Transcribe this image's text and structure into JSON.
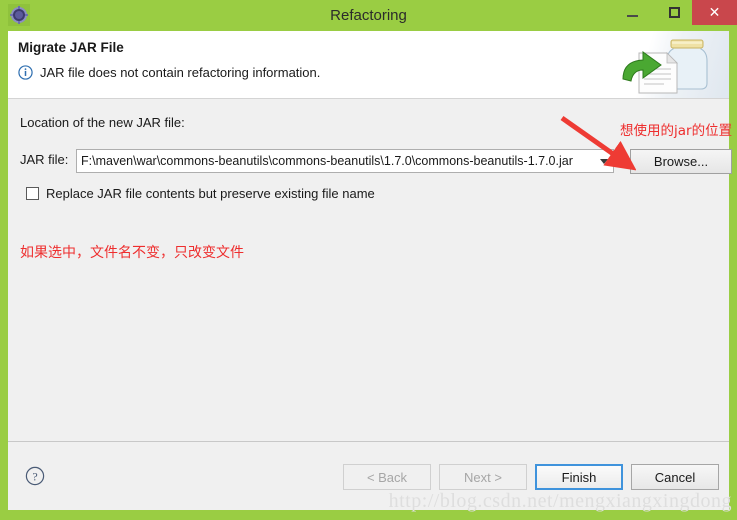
{
  "window": {
    "title": "Refactoring",
    "icon": "eclipse-gear-icon",
    "minimize_label": "–",
    "maximize_label": "□",
    "close_label": "✕",
    "chrome_color": "#9acd43",
    "close_color": "#c9474c"
  },
  "banner": {
    "title": "Migrate JAR File",
    "message": "JAR file does not contain refactoring information.",
    "info_icon": "info-circle-icon",
    "art_icon": "jar-migrate-icon"
  },
  "form": {
    "section_label": "Location of the new JAR file:",
    "jar_file_label": "JAR file:",
    "jar_file_value": "F:\\maven\\war\\commons-beanutils\\commons-beanutils\\1.7.0\\commons-beanutils-1.7.0.jar",
    "browse_label": "Browse...",
    "checkbox_label": "Replace JAR file contents but preserve existing file name",
    "checkbox_checked": false
  },
  "annotations": {
    "jar_location_note": "想使用的jar的位置",
    "checkbox_note": "如果选中，文件名不变，只改变文件",
    "color": "#ee2e2e",
    "arrow_icon": "red-arrow-icon"
  },
  "footer": {
    "help_icon": "help-circle-icon",
    "buttons": [
      {
        "label": "< Back",
        "state": "disabled"
      },
      {
        "label": "Next >",
        "state": "disabled"
      },
      {
        "label": "Finish",
        "state": "default"
      },
      {
        "label": "Cancel",
        "state": "normal"
      }
    ]
  },
  "watermark": {
    "text": "http://blog.csdn.net/mengxiangxingdong"
  }
}
